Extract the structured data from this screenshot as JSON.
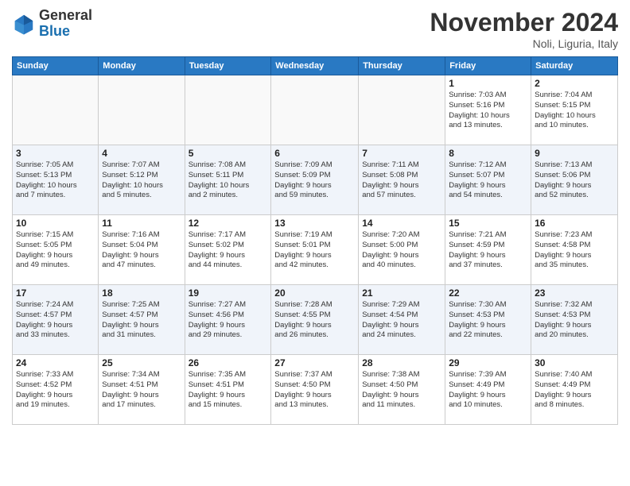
{
  "header": {
    "logo_line1": "General",
    "logo_line2": "Blue",
    "month": "November 2024",
    "location": "Noli, Liguria, Italy"
  },
  "days_of_week": [
    "Sunday",
    "Monday",
    "Tuesday",
    "Wednesday",
    "Thursday",
    "Friday",
    "Saturday"
  ],
  "weeks": [
    [
      {
        "day": "",
        "info": ""
      },
      {
        "day": "",
        "info": ""
      },
      {
        "day": "",
        "info": ""
      },
      {
        "day": "",
        "info": ""
      },
      {
        "day": "",
        "info": ""
      },
      {
        "day": "1",
        "info": "Sunrise: 7:03 AM\nSunset: 5:16 PM\nDaylight: 10 hours\nand 13 minutes."
      },
      {
        "day": "2",
        "info": "Sunrise: 7:04 AM\nSunset: 5:15 PM\nDaylight: 10 hours\nand 10 minutes."
      }
    ],
    [
      {
        "day": "3",
        "info": "Sunrise: 7:05 AM\nSunset: 5:13 PM\nDaylight: 10 hours\nand 7 minutes."
      },
      {
        "day": "4",
        "info": "Sunrise: 7:07 AM\nSunset: 5:12 PM\nDaylight: 10 hours\nand 5 minutes."
      },
      {
        "day": "5",
        "info": "Sunrise: 7:08 AM\nSunset: 5:11 PM\nDaylight: 10 hours\nand 2 minutes."
      },
      {
        "day": "6",
        "info": "Sunrise: 7:09 AM\nSunset: 5:09 PM\nDaylight: 9 hours\nand 59 minutes."
      },
      {
        "day": "7",
        "info": "Sunrise: 7:11 AM\nSunset: 5:08 PM\nDaylight: 9 hours\nand 57 minutes."
      },
      {
        "day": "8",
        "info": "Sunrise: 7:12 AM\nSunset: 5:07 PM\nDaylight: 9 hours\nand 54 minutes."
      },
      {
        "day": "9",
        "info": "Sunrise: 7:13 AM\nSunset: 5:06 PM\nDaylight: 9 hours\nand 52 minutes."
      }
    ],
    [
      {
        "day": "10",
        "info": "Sunrise: 7:15 AM\nSunset: 5:05 PM\nDaylight: 9 hours\nand 49 minutes."
      },
      {
        "day": "11",
        "info": "Sunrise: 7:16 AM\nSunset: 5:04 PM\nDaylight: 9 hours\nand 47 minutes."
      },
      {
        "day": "12",
        "info": "Sunrise: 7:17 AM\nSunset: 5:02 PM\nDaylight: 9 hours\nand 44 minutes."
      },
      {
        "day": "13",
        "info": "Sunrise: 7:19 AM\nSunset: 5:01 PM\nDaylight: 9 hours\nand 42 minutes."
      },
      {
        "day": "14",
        "info": "Sunrise: 7:20 AM\nSunset: 5:00 PM\nDaylight: 9 hours\nand 40 minutes."
      },
      {
        "day": "15",
        "info": "Sunrise: 7:21 AM\nSunset: 4:59 PM\nDaylight: 9 hours\nand 37 minutes."
      },
      {
        "day": "16",
        "info": "Sunrise: 7:23 AM\nSunset: 4:58 PM\nDaylight: 9 hours\nand 35 minutes."
      }
    ],
    [
      {
        "day": "17",
        "info": "Sunrise: 7:24 AM\nSunset: 4:57 PM\nDaylight: 9 hours\nand 33 minutes."
      },
      {
        "day": "18",
        "info": "Sunrise: 7:25 AM\nSunset: 4:57 PM\nDaylight: 9 hours\nand 31 minutes."
      },
      {
        "day": "19",
        "info": "Sunrise: 7:27 AM\nSunset: 4:56 PM\nDaylight: 9 hours\nand 29 minutes."
      },
      {
        "day": "20",
        "info": "Sunrise: 7:28 AM\nSunset: 4:55 PM\nDaylight: 9 hours\nand 26 minutes."
      },
      {
        "day": "21",
        "info": "Sunrise: 7:29 AM\nSunset: 4:54 PM\nDaylight: 9 hours\nand 24 minutes."
      },
      {
        "day": "22",
        "info": "Sunrise: 7:30 AM\nSunset: 4:53 PM\nDaylight: 9 hours\nand 22 minutes."
      },
      {
        "day": "23",
        "info": "Sunrise: 7:32 AM\nSunset: 4:53 PM\nDaylight: 9 hours\nand 20 minutes."
      }
    ],
    [
      {
        "day": "24",
        "info": "Sunrise: 7:33 AM\nSunset: 4:52 PM\nDaylight: 9 hours\nand 19 minutes."
      },
      {
        "day": "25",
        "info": "Sunrise: 7:34 AM\nSunset: 4:51 PM\nDaylight: 9 hours\nand 17 minutes."
      },
      {
        "day": "26",
        "info": "Sunrise: 7:35 AM\nSunset: 4:51 PM\nDaylight: 9 hours\nand 15 minutes."
      },
      {
        "day": "27",
        "info": "Sunrise: 7:37 AM\nSunset: 4:50 PM\nDaylight: 9 hours\nand 13 minutes."
      },
      {
        "day": "28",
        "info": "Sunrise: 7:38 AM\nSunset: 4:50 PM\nDaylight: 9 hours\nand 11 minutes."
      },
      {
        "day": "29",
        "info": "Sunrise: 7:39 AM\nSunset: 4:49 PM\nDaylight: 9 hours\nand 10 minutes."
      },
      {
        "day": "30",
        "info": "Sunrise: 7:40 AM\nSunset: 4:49 PM\nDaylight: 9 hours\nand 8 minutes."
      }
    ]
  ]
}
